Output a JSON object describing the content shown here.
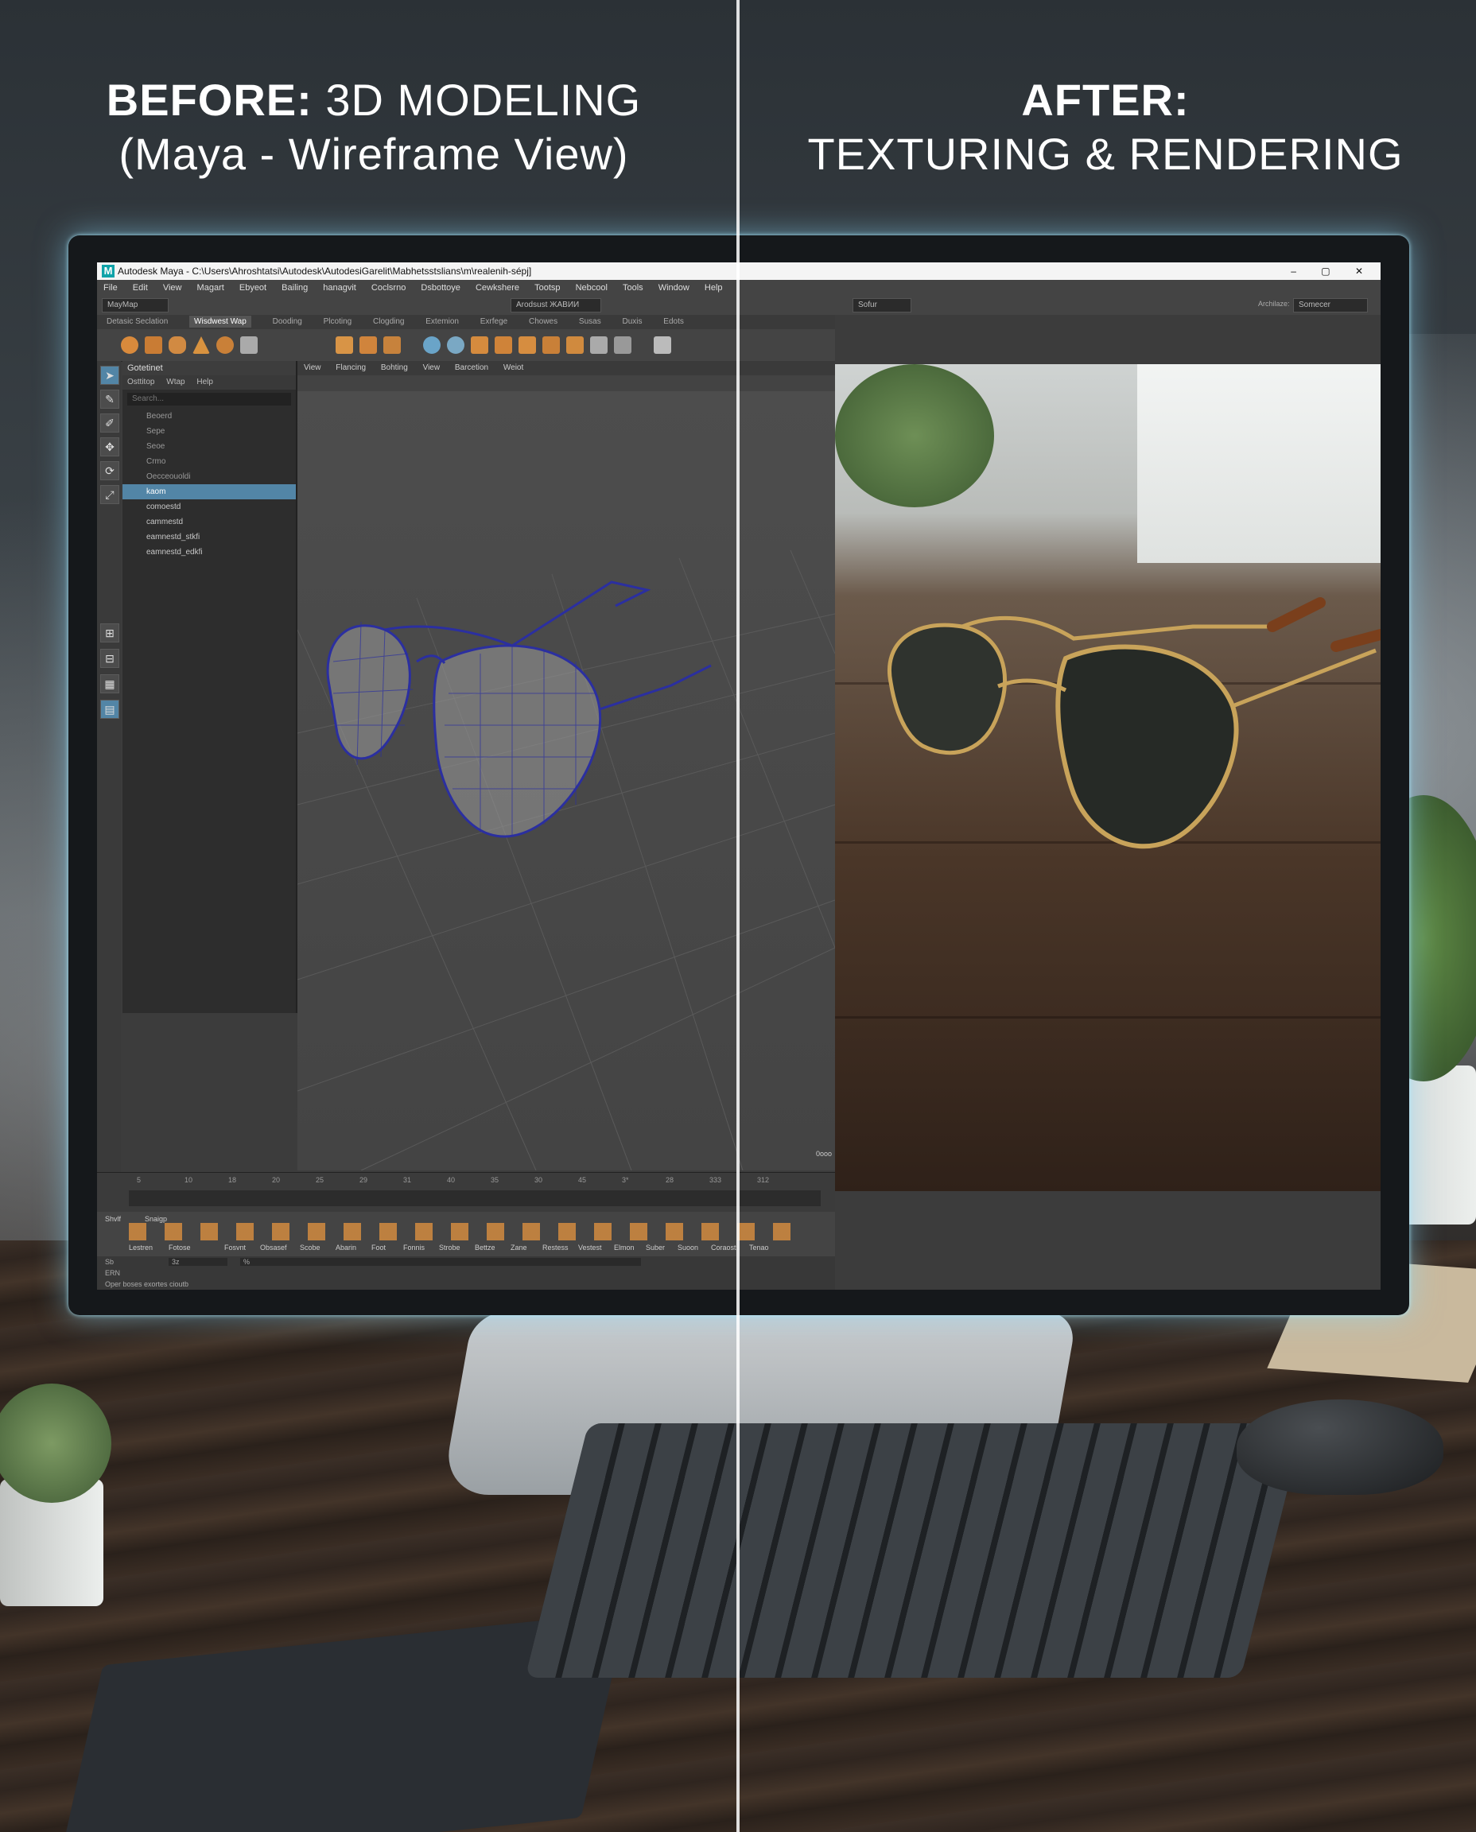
{
  "headline_left": {
    "bold": "BEFORE:",
    "text": "3D MODELING",
    "sub": "(Maya - Wireframe View)"
  },
  "headline_right": {
    "bold": "AFTER:",
    "sub": "TEXTURING & RENDERING"
  },
  "maya": {
    "title": "Autodesk Maya - C:\\Users\\Ahroshtatsi\\Autodesk\\AutodesiGarelit\\Mabhetsstslians\\m\\realenih-sépj]",
    "logo_letter": "M",
    "window_controls": "–  ▢  ✕",
    "menu": [
      "File",
      "Edit",
      "View",
      "Magart",
      "Ebyeot",
      "Bailing",
      "hanagvit",
      "Coclsrno",
      "Dsbottoye",
      "Cewkshere",
      "Tootsp",
      "Nebcool",
      "Tools",
      "Window",
      "Help"
    ],
    "mode_select": "MayMap",
    "status_field": "Arodsust ЖАВИИ",
    "workspace_label": "Archilaze:",
    "workspace_value": "Somecer",
    "setup_select": "Sofur",
    "shelf_tabs": [
      "Detasic Seclation",
      "Wisdwest Wap",
      "Dooding",
      "Plcoting",
      "Clogding",
      "Extemion",
      "Exrfege",
      "Chowes",
      "Susas",
      "Duxis",
      "Edots"
    ],
    "active_shelf_tab": "Wisdwest Wap",
    "outliner": {
      "title": "Gotetinet",
      "menu": [
        "Osttitop",
        "Wtap",
        "Help"
      ],
      "search_placeholder": "Search...",
      "items": [
        "Beoerd",
        "Sepe",
        "Seoe",
        "Crmo",
        "Oecceouoldi"
      ],
      "selected": "kaom",
      "children": [
        "comoestd",
        "cammestd",
        "eamnestd_stkfi",
        "eamnestd_edkfi"
      ]
    },
    "panel_menu": [
      "View",
      "Flancing",
      "Bohting",
      "View",
      "Barcetion",
      "Weiot"
    ],
    "time_ticks": [
      "5",
      "10",
      "18",
      "20",
      "25",
      "29",
      "31",
      "40",
      "35",
      "30",
      "45",
      "3*",
      "28",
      "333",
      "312"
    ],
    "frame_corner": "0ooo",
    "bottom_shelf_tabs": [
      "Shvlf",
      "Snaigp"
    ],
    "bottom_tools": [
      "Lestren",
      "Fotose",
      "Fosvnt",
      "Obsasef",
      "Scobe",
      "Abarin",
      "Foot",
      "Fonnis",
      "Strobe",
      "Bettze",
      "Zane",
      "Restess",
      "Vestest",
      "Elmon",
      "Suber",
      "Suoon",
      "Coraost",
      "Tenao"
    ],
    "command_labels": [
      "Sb",
      "ERN",
      "Oper boses exortes cioutb"
    ],
    "command_inputs": [
      "3z",
      "%"
    ]
  },
  "colors": {
    "accent": "#0fa3a9",
    "selection": "#5285a6",
    "wire": "#2b2fa0",
    "glow": "#8cdcff"
  }
}
